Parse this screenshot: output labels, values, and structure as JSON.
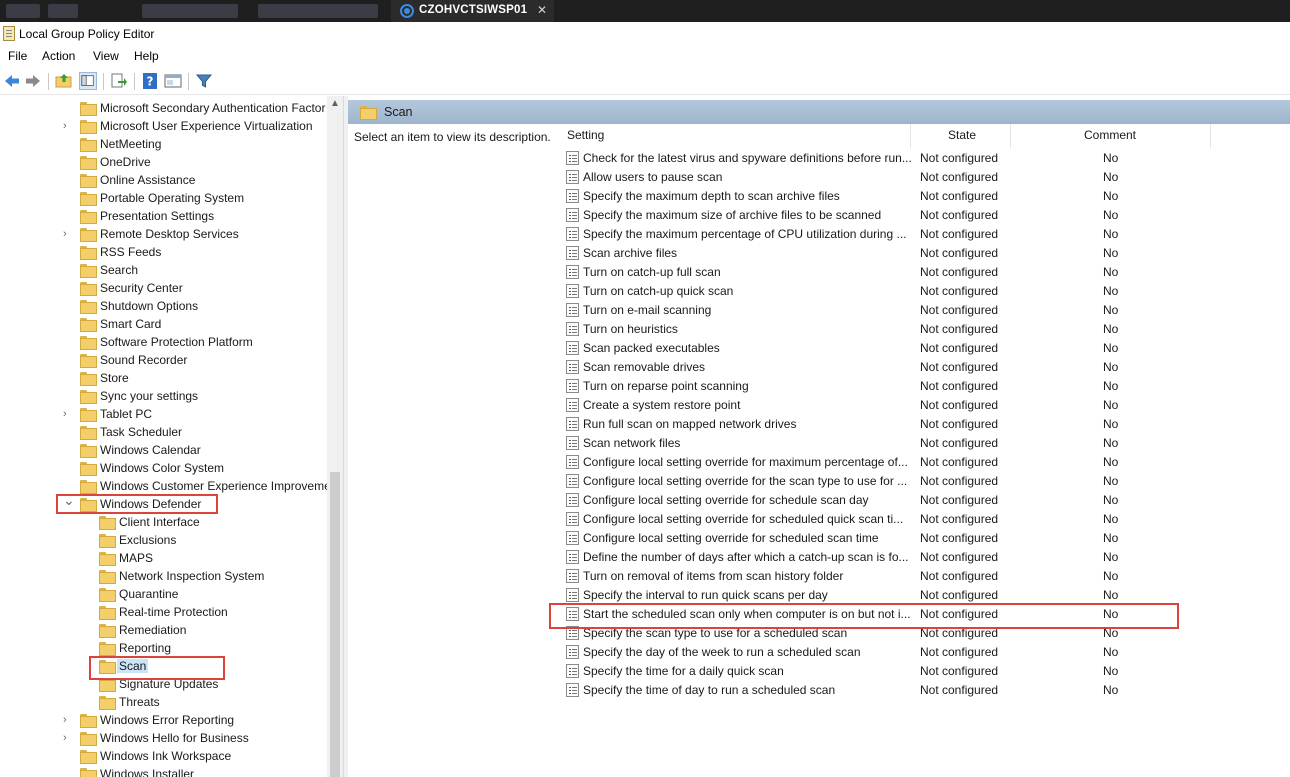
{
  "tab": {
    "title": "CZOHVCTSIWSP01",
    "close": "✕"
  },
  "window": {
    "title": "Local Group Policy Editor"
  },
  "menu": [
    "File",
    "Action",
    "View",
    "Help"
  ],
  "toolbar": [
    "back-icon",
    "forward-icon",
    "up-folder-icon",
    "show-hide-tree-icon",
    "export-list-icon",
    "help-icon",
    "properties-icon",
    "filter-icon"
  ],
  "tree": {
    "items": [
      {
        "label": "Microsoft Secondary Authentication Factor",
        "expander": false,
        "level": 1
      },
      {
        "label": "Microsoft User Experience Virtualization",
        "expander": true,
        "level": 1
      },
      {
        "label": "NetMeeting",
        "expander": false,
        "level": 1
      },
      {
        "label": "OneDrive",
        "expander": false,
        "level": 1
      },
      {
        "label": "Online Assistance",
        "expander": false,
        "level": 1
      },
      {
        "label": "Portable Operating System",
        "expander": false,
        "level": 1
      },
      {
        "label": "Presentation Settings",
        "expander": false,
        "level": 1
      },
      {
        "label": "Remote Desktop Services",
        "expander": true,
        "level": 1
      },
      {
        "label": "RSS Feeds",
        "expander": false,
        "level": 1
      },
      {
        "label": "Search",
        "expander": false,
        "level": 1
      },
      {
        "label": "Security Center",
        "expander": false,
        "level": 1
      },
      {
        "label": "Shutdown Options",
        "expander": false,
        "level": 1
      },
      {
        "label": "Smart Card",
        "expander": false,
        "level": 1
      },
      {
        "label": "Software Protection Platform",
        "expander": false,
        "level": 1
      },
      {
        "label": "Sound Recorder",
        "expander": false,
        "level": 1
      },
      {
        "label": "Store",
        "expander": false,
        "level": 1
      },
      {
        "label": "Sync your settings",
        "expander": false,
        "level": 1
      },
      {
        "label": "Tablet PC",
        "expander": true,
        "level": 1
      },
      {
        "label": "Task Scheduler",
        "expander": false,
        "level": 1
      },
      {
        "label": "Windows Calendar",
        "expander": false,
        "level": 1
      },
      {
        "label": "Windows Color System",
        "expander": false,
        "level": 1
      },
      {
        "label": "Windows Customer Experience Improvement Program",
        "expander": false,
        "level": 1
      },
      {
        "label": "Windows Defender",
        "expander": "open",
        "level": 1
      },
      {
        "label": "Client Interface",
        "expander": false,
        "level": 2
      },
      {
        "label": "Exclusions",
        "expander": false,
        "level": 2
      },
      {
        "label": "MAPS",
        "expander": false,
        "level": 2
      },
      {
        "label": "Network Inspection System",
        "expander": false,
        "level": 2
      },
      {
        "label": "Quarantine",
        "expander": false,
        "level": 2
      },
      {
        "label": "Real-time Protection",
        "expander": false,
        "level": 2
      },
      {
        "label": "Remediation",
        "expander": false,
        "level": 2
      },
      {
        "label": "Reporting",
        "expander": false,
        "level": 2
      },
      {
        "label": "Scan",
        "expander": false,
        "level": 2,
        "selected": true
      },
      {
        "label": "Signature Updates",
        "expander": false,
        "level": 2
      },
      {
        "label": "Threats",
        "expander": false,
        "level": 2
      },
      {
        "label": "Windows Error Reporting",
        "expander": true,
        "level": 1
      },
      {
        "label": "Windows Hello for Business",
        "expander": true,
        "level": 1
      },
      {
        "label": "Windows Ink Workspace",
        "expander": false,
        "level": 1
      },
      {
        "label": "Windows Installer",
        "expander": false,
        "level": 1
      }
    ]
  },
  "details": {
    "folder_title": "Scan",
    "description": "Select an item to view its description.",
    "columns": {
      "setting": "Setting",
      "state": "State",
      "comment": "Comment"
    },
    "rows": [
      {
        "name": "Check for the latest virus and spyware definitions before run...",
        "state": "Not configured",
        "comment": "No"
      },
      {
        "name": "Allow users to pause scan",
        "state": "Not configured",
        "comment": "No"
      },
      {
        "name": "Specify the maximum depth to scan archive files",
        "state": "Not configured",
        "comment": "No"
      },
      {
        "name": "Specify the maximum size of archive files to be scanned",
        "state": "Not configured",
        "comment": "No"
      },
      {
        "name": "Specify the maximum percentage of CPU utilization during ...",
        "state": "Not configured",
        "comment": "No"
      },
      {
        "name": "Scan archive files",
        "state": "Not configured",
        "comment": "No"
      },
      {
        "name": "Turn on catch-up full scan",
        "state": "Not configured",
        "comment": "No"
      },
      {
        "name": "Turn on catch-up quick scan",
        "state": "Not configured",
        "comment": "No"
      },
      {
        "name": "Turn on e-mail scanning",
        "state": "Not configured",
        "comment": "No"
      },
      {
        "name": "Turn on heuristics",
        "state": "Not configured",
        "comment": "No"
      },
      {
        "name": "Scan packed executables",
        "state": "Not configured",
        "comment": "No"
      },
      {
        "name": "Scan removable drives",
        "state": "Not configured",
        "comment": "No"
      },
      {
        "name": "Turn on reparse point scanning",
        "state": "Not configured",
        "comment": "No"
      },
      {
        "name": "Create a system restore point",
        "state": "Not configured",
        "comment": "No"
      },
      {
        "name": "Run full scan on mapped network drives",
        "state": "Not configured",
        "comment": "No"
      },
      {
        "name": "Scan network files",
        "state": "Not configured",
        "comment": "No"
      },
      {
        "name": "Configure local setting override for maximum percentage of...",
        "state": "Not configured",
        "comment": "No"
      },
      {
        "name": "Configure local setting override for the scan type to use for ...",
        "state": "Not configured",
        "comment": "No"
      },
      {
        "name": "Configure local setting override for schedule scan day",
        "state": "Not configured",
        "comment": "No"
      },
      {
        "name": "Configure local setting override for scheduled quick scan ti...",
        "state": "Not configured",
        "comment": "No"
      },
      {
        "name": "Configure local setting override for scheduled scan time",
        "state": "Not configured",
        "comment": "No"
      },
      {
        "name": "Define the number of days after which a catch-up scan is fo...",
        "state": "Not configured",
        "comment": "No"
      },
      {
        "name": "Turn on removal of items from scan history folder",
        "state": "Not configured",
        "comment": "No"
      },
      {
        "name": "Specify the interval to run quick scans per day",
        "state": "Not configured",
        "comment": "No"
      },
      {
        "name": "Start the scheduled scan only when computer is on but not i...",
        "state": "Not configured",
        "comment": "No"
      },
      {
        "name": "Specify the scan type to use for a scheduled scan",
        "state": "Not configured",
        "comment": "No"
      },
      {
        "name": "Specify the day of the week to run a scheduled scan",
        "state": "Not configured",
        "comment": "No"
      },
      {
        "name": "Specify the time for a daily quick scan",
        "state": "Not configured",
        "comment": "No"
      },
      {
        "name": "Specify the time of day to run a scheduled scan",
        "state": "Not configured",
        "comment": "No"
      }
    ]
  },
  "highlight_color": "#d9453c",
  "selection_color": "#cce4f7"
}
